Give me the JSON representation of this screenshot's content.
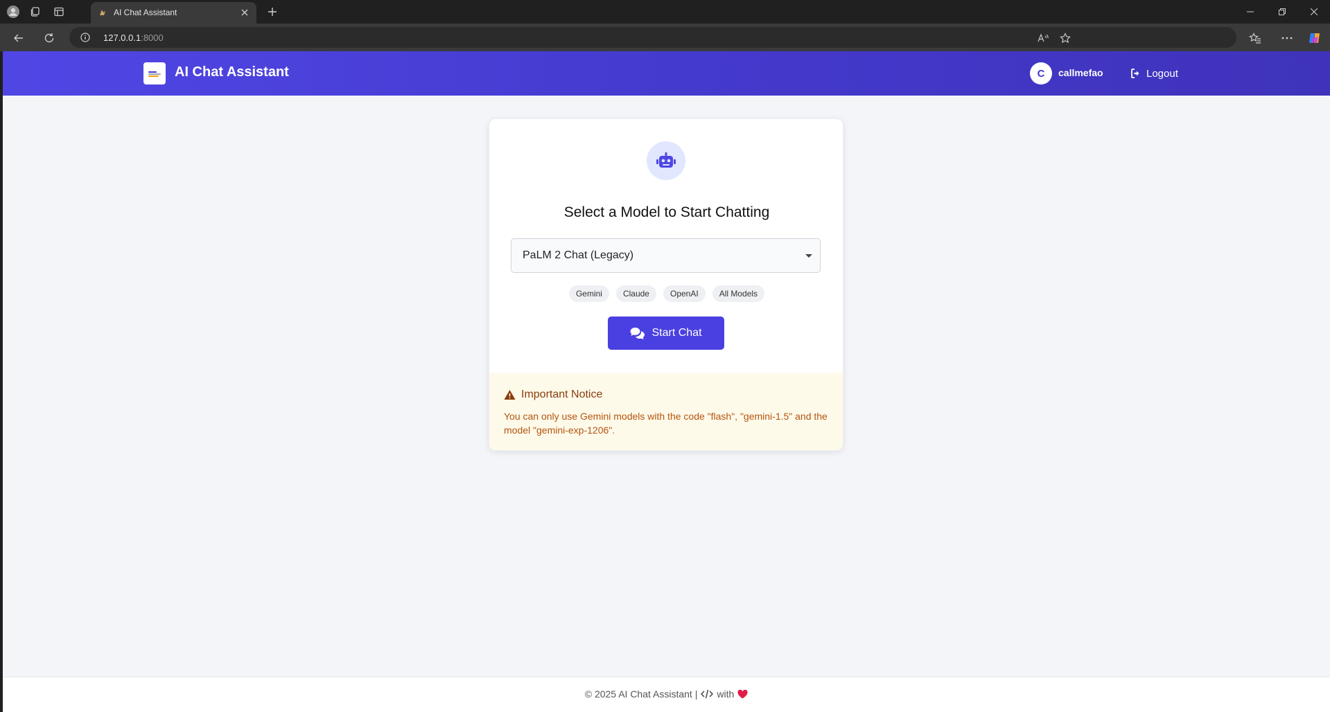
{
  "browser": {
    "tab_title": "AI Chat Assistant",
    "url_host": "127.0.0.1",
    "url_port": ":8000"
  },
  "app": {
    "brand_title": "AI Chat Assistant",
    "user_initial": "C",
    "username": "callmefao",
    "logout_label": "Logout"
  },
  "card": {
    "heading": "Select a Model to Start Chatting",
    "selected_model": "PaLM 2 Chat (Legacy)",
    "filters": [
      "Gemini",
      "Claude",
      "OpenAI",
      "All Models"
    ],
    "start_label": "Start Chat"
  },
  "notice": {
    "title": "Important Notice",
    "text": "You can only use Gemini models with the code \"flash\", \"gemini-1.5\" and the model \"gemini-exp-1206\"."
  },
  "footer": {
    "copyright": "© 2025 AI Chat Assistant |",
    "with": "with"
  },
  "colors": {
    "accent": "#4a3fe0",
    "header_start": "#5046e5",
    "header_end": "#3f33bb",
    "notice_bg": "#fefaea",
    "notice_text": "#b4540c",
    "heart": "#e11d48"
  }
}
